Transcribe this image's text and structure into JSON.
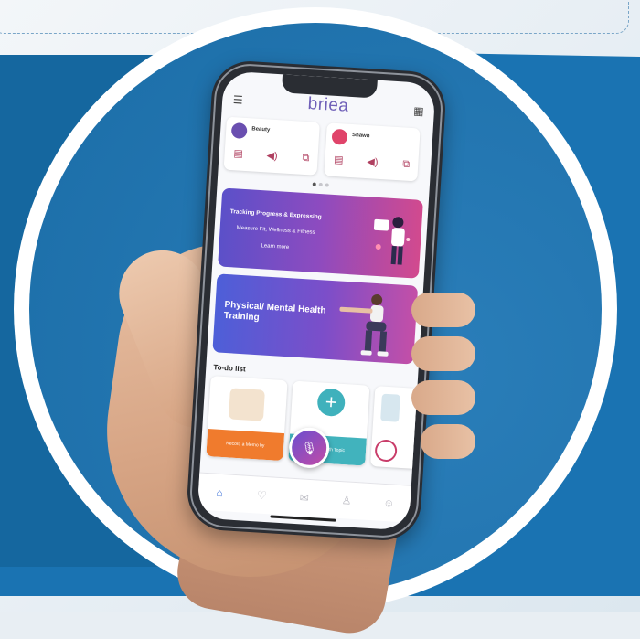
{
  "app": {
    "logo_text": "briea",
    "brand_color": "#6f5fb8"
  },
  "header": {
    "left_icon": "menu-icon",
    "right_icon": "calendar-icon"
  },
  "profile_cards": [
    {
      "name": "Beauty",
      "avatar_color": "#6a4fb0",
      "icons": [
        "notes-icon",
        "speaker-icon",
        "share-icon"
      ]
    },
    {
      "name": "Shawn",
      "avatar_color": "#e0446a",
      "icons": [
        "notes-icon",
        "speaker-icon",
        "share-icon"
      ]
    }
  ],
  "carousel": {
    "active_index": 0,
    "count": 3
  },
  "banner_primary": {
    "title": "Tracking Progress & Expressing",
    "subtitle": "Measure Fit, Wellness & Fitness",
    "cta": "Learn more"
  },
  "banner_secondary": {
    "title": "Physical/ Mental Health Training"
  },
  "todo": {
    "title": "To-do list",
    "items": [
      {
        "label": "Record a Memo by",
        "color": "#f07b2d"
      },
      {
        "label": "Add Health Topic",
        "color": "#41b3bd"
      },
      {
        "label": "",
        "color": "#ffffff"
      }
    ]
  },
  "tabbar": {
    "items": [
      {
        "name": "tab-home",
        "icon": "⌂",
        "active": true
      },
      {
        "name": "tab-health",
        "icon": "♡",
        "active": false
      },
      {
        "name": "tab-messages",
        "icon": "✉",
        "active": false
      },
      {
        "name": "tab-people",
        "icon": "♙",
        "active": false
      },
      {
        "name": "tab-profile",
        "icon": "☺",
        "active": false
      }
    ]
  },
  "colors": {
    "background_blue": "#1a73b2",
    "ring_white": "#ffffff",
    "banner_gradient_start": "#5b50c9",
    "banner_gradient_end": "#d24a8e"
  }
}
